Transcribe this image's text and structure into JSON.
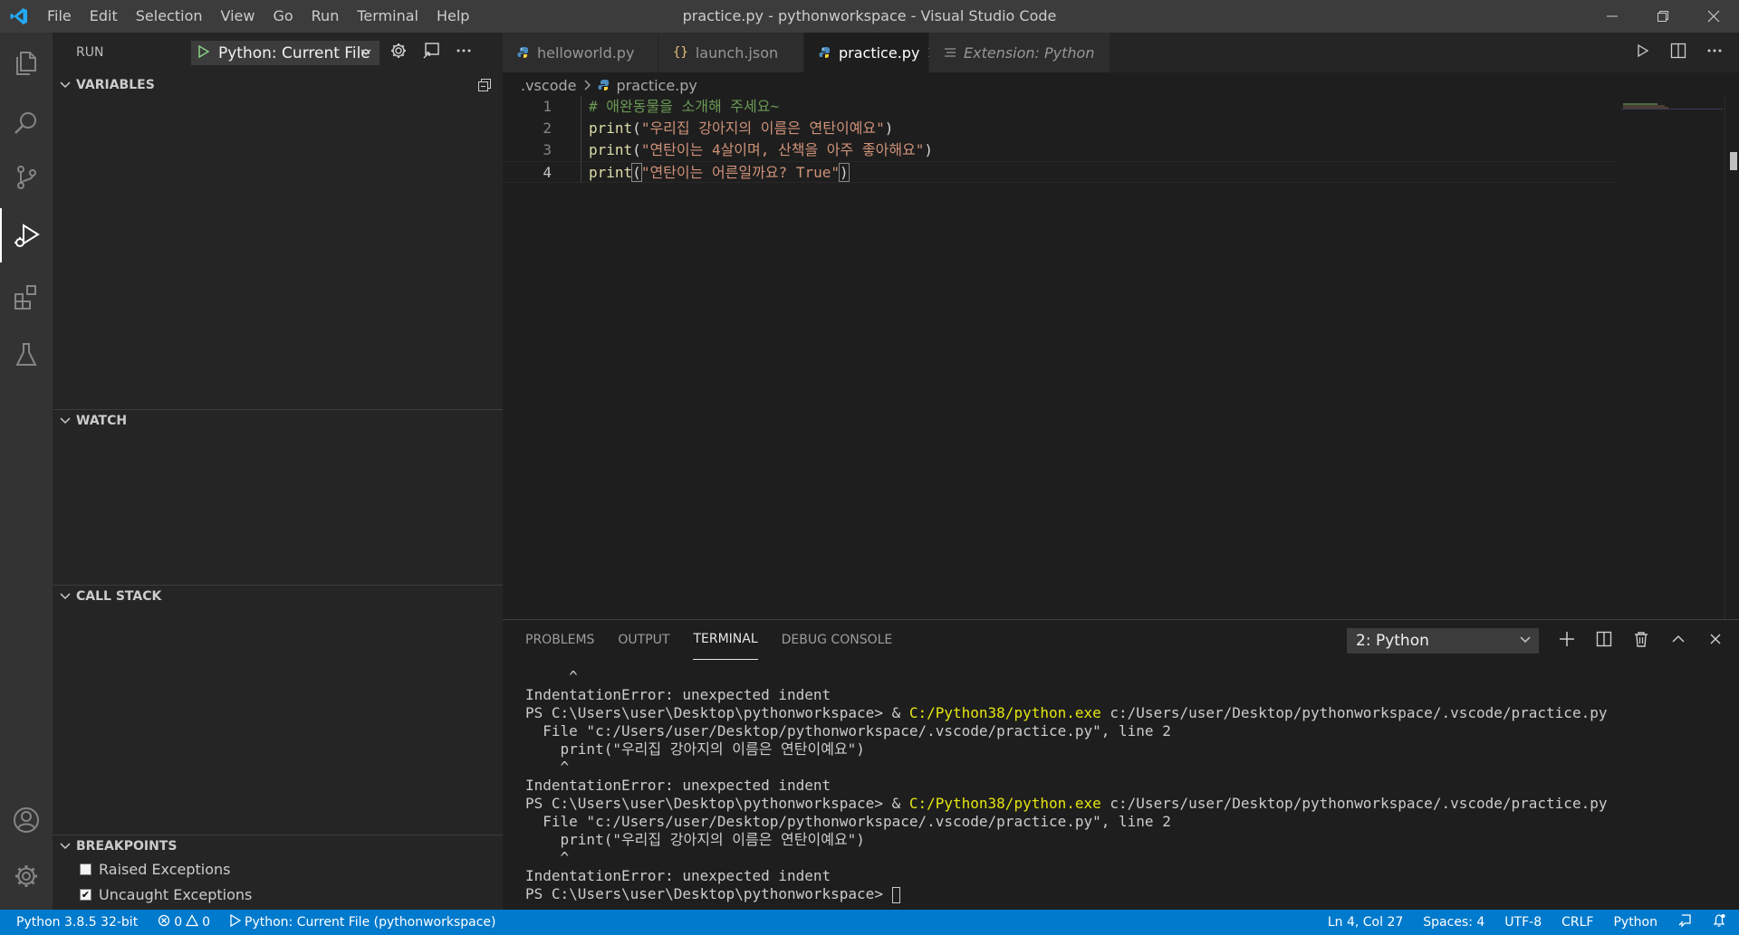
{
  "window": {
    "title": "practice.py - pythonworkspace - Visual Studio Code",
    "menu": [
      "File",
      "Edit",
      "Selection",
      "View",
      "Go",
      "Run",
      "Terminal",
      "Help"
    ]
  },
  "sidebar": {
    "header": "RUN",
    "config": "Python: Current File",
    "sections": {
      "variables": "VARIABLES",
      "watch": "WATCH",
      "callstack": "CALL STACK",
      "breakpoints": "BREAKPOINTS"
    },
    "breakpoints": [
      {
        "label": "Raised Exceptions",
        "checked": false
      },
      {
        "label": "Uncaught Exceptions",
        "checked": true
      }
    ]
  },
  "tabs": [
    {
      "label": "helloworld.py",
      "icon": "python-icon",
      "active": false
    },
    {
      "label": "launch.json",
      "icon": "json-braces-icon",
      "active": false
    },
    {
      "label": "practice.py",
      "icon": "python-icon",
      "active": true
    },
    {
      "label": "Extension: Python",
      "icon": "extension-preview-icon",
      "active": false
    }
  ],
  "breadcrumb": {
    "folder": ".vscode",
    "file": "practice.py"
  },
  "editor": {
    "line_numbers": [
      "1",
      "2",
      "3",
      "4"
    ],
    "lines": [
      {
        "comment": "# 애완동물을 소개해 주세요~"
      },
      {
        "fn": "print",
        "open": "(",
        "str": "\"우리집 강아지의 이름은 연탄이예요\"",
        "close": ")"
      },
      {
        "fn": "print",
        "open": "(",
        "str": "\"연탄이는 4살이며, 산책을 아주 좋아해요\"",
        "close": ")"
      },
      {
        "fn": "print",
        "open": "(",
        "str": "\"연탄이는 어른일까요? True\"",
        "close": ")"
      }
    ]
  },
  "panel": {
    "tabs": [
      "PROBLEMS",
      "OUTPUT",
      "TERMINAL",
      "DEBUG CONSOLE"
    ],
    "active_tab": "TERMINAL",
    "terminal_select": "2: Python",
    "terminal": {
      "caret": "     ^",
      "error": "IndentationError: unexpected indent",
      "prompt": "PS C:\\Users\\user\\Desktop\\pythonworkspace> ",
      "amp": "& ",
      "exe": "C:/Python38/python.exe",
      "script": " c:/Users/user/Desktop/pythonworkspace/.vscode/practice.py",
      "file_line": "  File \"c:/Users/user/Desktop/pythonworkspace/.vscode/practice.py\", line 2",
      "code_line": "    print(\"우리집 강아지의 이름은 연탄이예요\")",
      "caret2": "    ^"
    }
  },
  "status": {
    "interpreter": "Python 3.8.5 32-bit",
    "errors": "0",
    "warnings": "0",
    "debug": "Python: Current File (pythonworkspace)",
    "position": "Ln 4, Col 27",
    "spaces": "Spaces: 4",
    "encoding": "UTF-8",
    "eol": "CRLF",
    "language": "Python"
  },
  "colors": {
    "accent": "#007acc",
    "comment": "#6a9955",
    "string": "#ce9178",
    "function": "#dcdcaa"
  }
}
